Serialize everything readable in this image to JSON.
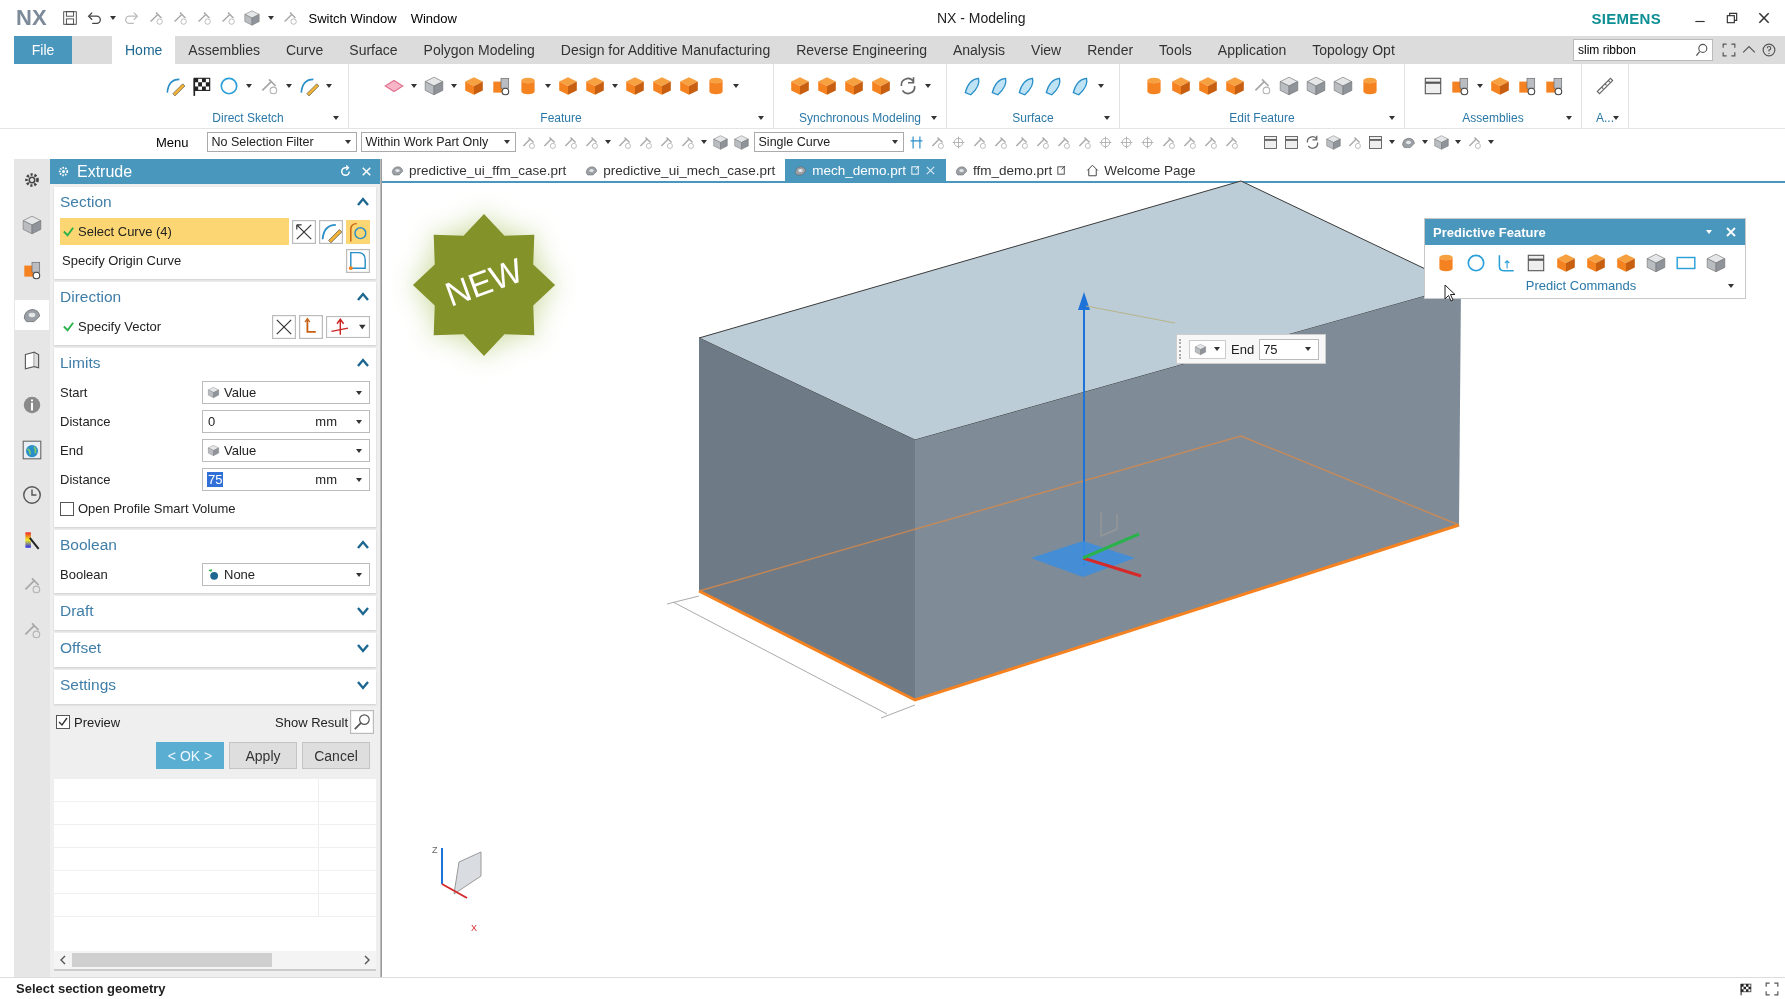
{
  "title_bar": {
    "logo": "NX",
    "switch_window": "Switch Window",
    "window_menu": "Window",
    "title": "NX - Modeling",
    "brand": "SIEMENS"
  },
  "menu_tabs": [
    {
      "label": "File",
      "selected": false,
      "kind": "file"
    },
    {
      "label": "Home",
      "selected": true,
      "kind": "tab"
    },
    {
      "label": "Assemblies",
      "selected": false,
      "kind": "tab"
    },
    {
      "label": "Curve",
      "selected": false,
      "kind": "tab"
    },
    {
      "label": "Surface",
      "selected": false,
      "kind": "tab"
    },
    {
      "label": "Polygon Modeling",
      "selected": false,
      "kind": "tab"
    },
    {
      "label": "Design for Additive Manufacturing",
      "selected": false,
      "kind": "tab"
    },
    {
      "label": "Reverse Engineering",
      "selected": false,
      "kind": "tab"
    },
    {
      "label": "Analysis",
      "selected": false,
      "kind": "tab"
    },
    {
      "label": "View",
      "selected": false,
      "kind": "tab"
    },
    {
      "label": "Render",
      "selected": false,
      "kind": "tab"
    },
    {
      "label": "Tools",
      "selected": false,
      "kind": "tab"
    },
    {
      "label": "Application",
      "selected": false,
      "kind": "tab"
    },
    {
      "label": "Topology Opt",
      "selected": false,
      "kind": "tab"
    }
  ],
  "command_search": {
    "value": "slim ribbon"
  },
  "ribbon_groups": [
    {
      "label": "Direct Sketch"
    },
    {
      "label": "Feature"
    },
    {
      "label": "Synchronous Modeling"
    },
    {
      "label": "Surface"
    },
    {
      "label": "Edit Feature"
    },
    {
      "label": "Assemblies"
    },
    {
      "label": "A..."
    }
  ],
  "selection_bar": {
    "menu": "Menu",
    "filter": "No Selection Filter",
    "scope": "Within Work Part Only",
    "curve_rule": "Single Curve"
  },
  "dialog": {
    "title": "Extrude",
    "sections": [
      {
        "title": "Section",
        "expanded": true,
        "rows": [
          {
            "kind": "curve-select",
            "label": "Select Curve (4)",
            "checked": true,
            "selected": true
          },
          {
            "kind": "origin-curve",
            "label": "Specify Origin Curve",
            "checked": false,
            "selected": false
          }
        ]
      },
      {
        "title": "Direction",
        "expanded": true,
        "rows": [
          {
            "kind": "vector-select",
            "label": "Specify Vector",
            "checked": true,
            "selected": false
          }
        ]
      },
      {
        "title": "Limits",
        "expanded": true,
        "rows": [
          {
            "kind": "dropdown",
            "label": "Start",
            "value": "Value"
          },
          {
            "kind": "number",
            "label": "Distance",
            "value": "0",
            "unit": "mm",
            "selected": false
          },
          {
            "kind": "dropdown",
            "label": "End",
            "value": "Value"
          },
          {
            "kind": "number",
            "label": "Distance",
            "value": "75",
            "unit": "mm",
            "selected": true
          },
          {
            "kind": "checkbox",
            "label": "Open Profile Smart Volume",
            "checked": false
          }
        ]
      },
      {
        "title": "Boolean",
        "expanded": true,
        "rows": [
          {
            "kind": "boolean",
            "label": "Boolean",
            "value": "None"
          }
        ]
      },
      {
        "title": "Draft",
        "expanded": false
      },
      {
        "title": "Offset",
        "expanded": false
      },
      {
        "title": "Settings",
        "expanded": false
      }
    ],
    "preview": {
      "label": "Preview",
      "checked": true
    },
    "show_result": "Show Result",
    "buttons": [
      {
        "label": "< OK >",
        "kind": "primary"
      },
      {
        "label": "Apply",
        "kind": "normal"
      },
      {
        "label": "Cancel",
        "kind": "normal"
      }
    ]
  },
  "file_tabs": [
    {
      "label": "predictive_ui_ffm_case.prt",
      "selected": false,
      "kind": "part"
    },
    {
      "label": "predictive_ui_mech_case.prt",
      "selected": false,
      "kind": "part"
    },
    {
      "label": "mech_demo.prt",
      "selected": true,
      "kind": "part"
    },
    {
      "label": "ffm_demo.prt",
      "selected": false,
      "kind": "part"
    },
    {
      "label": "Welcome Page",
      "selected": false,
      "kind": "home"
    }
  ],
  "badge": "NEW",
  "end_handle": {
    "label": "End",
    "value": "75"
  },
  "predictive_panel": {
    "title": "Predictive Feature",
    "label": "Predict Commands"
  },
  "triad": {
    "z": "Z",
    "x": "X"
  },
  "status_bar": {
    "prompt": "Select section geometry"
  }
}
